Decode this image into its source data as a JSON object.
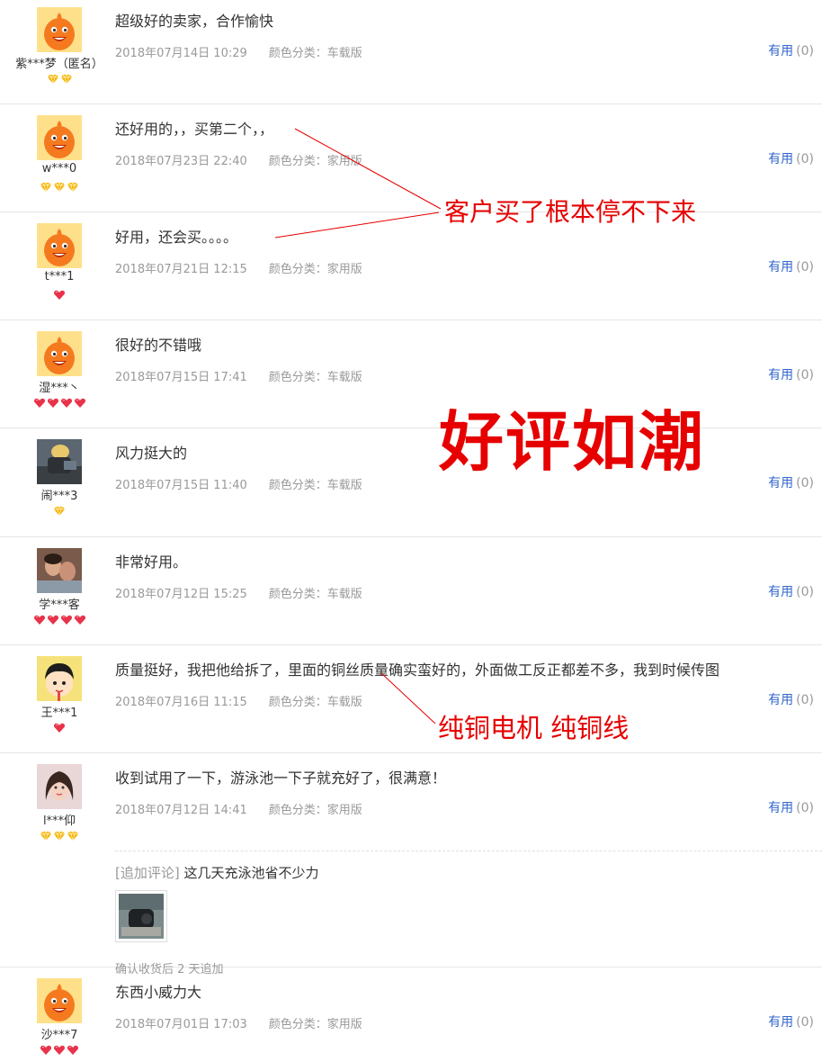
{
  "reviews": [
    {
      "user": "紫***梦（匿名）",
      "avatar": "taobao-mascot-icon",
      "badge_type": "diamond-gold",
      "badge_count": 2,
      "content": "超级好的卖家，合作愉快",
      "date": "2018年07月14日 10:29",
      "sku": "颜色分类：车载版",
      "useful_label": "有用",
      "useful_count": "(0)"
    },
    {
      "user": "w***0",
      "avatar": "taobao-mascot-icon",
      "badge_type": "diamond-gold",
      "badge_count": 3,
      "content": "还好用的，，买第二个，，",
      "date": "2018年07月23日 22:40",
      "sku": "颜色分类：家用版",
      "useful_label": "有用",
      "useful_count": "(0)"
    },
    {
      "user": "t***1",
      "avatar": "taobao-mascot-icon",
      "badge_type": "heart-red",
      "badge_count": 1,
      "content": "好用，还会买。。。。",
      "date": "2018年07月21日 12:15",
      "sku": "颜色分类：家用版",
      "useful_label": "有用",
      "useful_count": "(0)"
    },
    {
      "user": "湿***丶",
      "avatar": "taobao-mascot-icon",
      "badge_type": "heart-red",
      "badge_count": 4,
      "content": "很好的不错哦",
      "date": "2018年07月15日 17:41",
      "sku": "颜色分类：车载版",
      "useful_label": "有用",
      "useful_count": "(0)"
    },
    {
      "user": "闹***3",
      "avatar": "photo-avatar-icon",
      "badge_type": "diamond-gold",
      "badge_count": 1,
      "content": "风力挺大的",
      "date": "2018年07月15日 11:40",
      "sku": "颜色分类：车载版",
      "useful_label": "有用",
      "useful_count": "(0)"
    },
    {
      "user": "学***客",
      "avatar": "photo-avatar-icon",
      "badge_type": "heart-red",
      "badge_count": 4,
      "content": "非常好用。",
      "date": "2018年07月12日 15:25",
      "sku": "颜色分类：车载版",
      "useful_label": "有用",
      "useful_count": "(0)"
    },
    {
      "user": "王***1",
      "avatar": "cartoon-avatar-icon",
      "badge_type": "heart-red",
      "badge_count": 1,
      "content": "质量挺好，我把他给拆了，里面的铜丝质量确实蛮好的，外面做工反正都差不多，我到时候传图",
      "date": "2018年07月16日 11:15",
      "sku": "颜色分类：车载版",
      "useful_label": "有用",
      "useful_count": "(0)"
    },
    {
      "user": "l***仰",
      "avatar": "photo-avatar-icon",
      "badge_type": "diamond-gold",
      "badge_count": 3,
      "content": "收到试用了一下，游泳池一下子就充好了，很满意！",
      "date": "2018年07月12日 14:41",
      "sku": "颜色分类：家用版",
      "useful_label": "有用",
      "useful_count": "(0)",
      "append": {
        "tag": "[追加评论]",
        "text": " 这几天充泳池省不少力",
        "thumb": "product-photo-icon",
        "note": "确认收货后 2 天追加"
      }
    },
    {
      "user": "沙***7",
      "avatar": "taobao-mascot-icon",
      "badge_type": "heart-red",
      "badge_count": 3,
      "content": "东西小威力大",
      "date": "2018年07月01日 17:03",
      "sku": "颜色分类：家用版",
      "useful_label": "有用",
      "useful_count": "(0)"
    }
  ],
  "annotations": {
    "customers_rebuy": "客户买了根本停不下来",
    "praise_flood": "好评如潮",
    "pure_copper": "纯铜电机  纯铜线"
  },
  "colors": {
    "annotation_red": "#e60000",
    "useful_link": "#3366cc",
    "meta_gray": "#999999",
    "divider": "#e6e6e6",
    "mascot_orange": "#f57a1f",
    "badge_gold": "#f5b100",
    "badge_red": "#e8334a"
  }
}
